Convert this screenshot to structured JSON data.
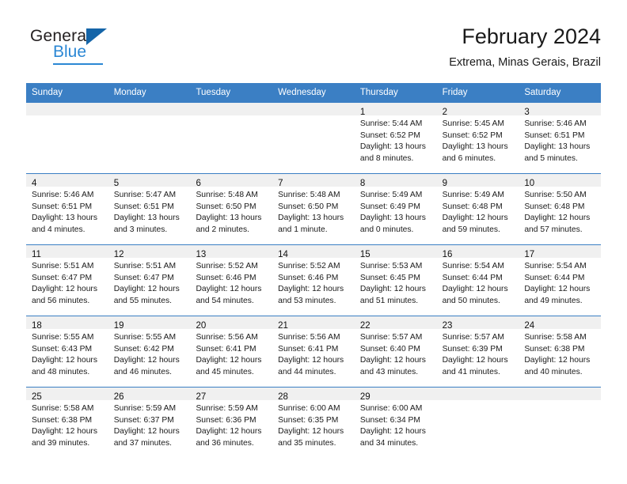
{
  "brand": {
    "name_top": "General",
    "name_bottom": "Blue",
    "accent_color": "#2b87d4",
    "triangle_color": "#1565a8"
  },
  "header": {
    "title": "February 2024",
    "subtitle": "Extrema, Minas Gerais, Brazil"
  },
  "calendar": {
    "header_bg": "#3b7fc4",
    "weekdays": [
      "Sunday",
      "Monday",
      "Tuesday",
      "Wednesday",
      "Thursday",
      "Friday",
      "Saturday"
    ],
    "weeks": [
      [
        {
          "day": "",
          "sunrise": "",
          "sunset": "",
          "daylight": "",
          "daylight2": ""
        },
        {
          "day": "",
          "sunrise": "",
          "sunset": "",
          "daylight": "",
          "daylight2": ""
        },
        {
          "day": "",
          "sunrise": "",
          "sunset": "",
          "daylight": "",
          "daylight2": ""
        },
        {
          "day": "",
          "sunrise": "",
          "sunset": "",
          "daylight": "",
          "daylight2": ""
        },
        {
          "day": "1",
          "sunrise": "Sunrise: 5:44 AM",
          "sunset": "Sunset: 6:52 PM",
          "daylight": "Daylight: 13 hours",
          "daylight2": "and 8 minutes."
        },
        {
          "day": "2",
          "sunrise": "Sunrise: 5:45 AM",
          "sunset": "Sunset: 6:52 PM",
          "daylight": "Daylight: 13 hours",
          "daylight2": "and 6 minutes."
        },
        {
          "day": "3",
          "sunrise": "Sunrise: 5:46 AM",
          "sunset": "Sunset: 6:51 PM",
          "daylight": "Daylight: 13 hours",
          "daylight2": "and 5 minutes."
        }
      ],
      [
        {
          "day": "4",
          "sunrise": "Sunrise: 5:46 AM",
          "sunset": "Sunset: 6:51 PM",
          "daylight": "Daylight: 13 hours",
          "daylight2": "and 4 minutes."
        },
        {
          "day": "5",
          "sunrise": "Sunrise: 5:47 AM",
          "sunset": "Sunset: 6:51 PM",
          "daylight": "Daylight: 13 hours",
          "daylight2": "and 3 minutes."
        },
        {
          "day": "6",
          "sunrise": "Sunrise: 5:48 AM",
          "sunset": "Sunset: 6:50 PM",
          "daylight": "Daylight: 13 hours",
          "daylight2": "and 2 minutes."
        },
        {
          "day": "7",
          "sunrise": "Sunrise: 5:48 AM",
          "sunset": "Sunset: 6:50 PM",
          "daylight": "Daylight: 13 hours",
          "daylight2": "and 1 minute."
        },
        {
          "day": "8",
          "sunrise": "Sunrise: 5:49 AM",
          "sunset": "Sunset: 6:49 PM",
          "daylight": "Daylight: 13 hours",
          "daylight2": "and 0 minutes."
        },
        {
          "day": "9",
          "sunrise": "Sunrise: 5:49 AM",
          "sunset": "Sunset: 6:48 PM",
          "daylight": "Daylight: 12 hours",
          "daylight2": "and 59 minutes."
        },
        {
          "day": "10",
          "sunrise": "Sunrise: 5:50 AM",
          "sunset": "Sunset: 6:48 PM",
          "daylight": "Daylight: 12 hours",
          "daylight2": "and 57 minutes."
        }
      ],
      [
        {
          "day": "11",
          "sunrise": "Sunrise: 5:51 AM",
          "sunset": "Sunset: 6:47 PM",
          "daylight": "Daylight: 12 hours",
          "daylight2": "and 56 minutes."
        },
        {
          "day": "12",
          "sunrise": "Sunrise: 5:51 AM",
          "sunset": "Sunset: 6:47 PM",
          "daylight": "Daylight: 12 hours",
          "daylight2": "and 55 minutes."
        },
        {
          "day": "13",
          "sunrise": "Sunrise: 5:52 AM",
          "sunset": "Sunset: 6:46 PM",
          "daylight": "Daylight: 12 hours",
          "daylight2": "and 54 minutes."
        },
        {
          "day": "14",
          "sunrise": "Sunrise: 5:52 AM",
          "sunset": "Sunset: 6:46 PM",
          "daylight": "Daylight: 12 hours",
          "daylight2": "and 53 minutes."
        },
        {
          "day": "15",
          "sunrise": "Sunrise: 5:53 AM",
          "sunset": "Sunset: 6:45 PM",
          "daylight": "Daylight: 12 hours",
          "daylight2": "and 51 minutes."
        },
        {
          "day": "16",
          "sunrise": "Sunrise: 5:54 AM",
          "sunset": "Sunset: 6:44 PM",
          "daylight": "Daylight: 12 hours",
          "daylight2": "and 50 minutes."
        },
        {
          "day": "17",
          "sunrise": "Sunrise: 5:54 AM",
          "sunset": "Sunset: 6:44 PM",
          "daylight": "Daylight: 12 hours",
          "daylight2": "and 49 minutes."
        }
      ],
      [
        {
          "day": "18",
          "sunrise": "Sunrise: 5:55 AM",
          "sunset": "Sunset: 6:43 PM",
          "daylight": "Daylight: 12 hours",
          "daylight2": "and 48 minutes."
        },
        {
          "day": "19",
          "sunrise": "Sunrise: 5:55 AM",
          "sunset": "Sunset: 6:42 PM",
          "daylight": "Daylight: 12 hours",
          "daylight2": "and 46 minutes."
        },
        {
          "day": "20",
          "sunrise": "Sunrise: 5:56 AM",
          "sunset": "Sunset: 6:41 PM",
          "daylight": "Daylight: 12 hours",
          "daylight2": "and 45 minutes."
        },
        {
          "day": "21",
          "sunrise": "Sunrise: 5:56 AM",
          "sunset": "Sunset: 6:41 PM",
          "daylight": "Daylight: 12 hours",
          "daylight2": "and 44 minutes."
        },
        {
          "day": "22",
          "sunrise": "Sunrise: 5:57 AM",
          "sunset": "Sunset: 6:40 PM",
          "daylight": "Daylight: 12 hours",
          "daylight2": "and 43 minutes."
        },
        {
          "day": "23",
          "sunrise": "Sunrise: 5:57 AM",
          "sunset": "Sunset: 6:39 PM",
          "daylight": "Daylight: 12 hours",
          "daylight2": "and 41 minutes."
        },
        {
          "day": "24",
          "sunrise": "Sunrise: 5:58 AM",
          "sunset": "Sunset: 6:38 PM",
          "daylight": "Daylight: 12 hours",
          "daylight2": "and 40 minutes."
        }
      ],
      [
        {
          "day": "25",
          "sunrise": "Sunrise: 5:58 AM",
          "sunset": "Sunset: 6:38 PM",
          "daylight": "Daylight: 12 hours",
          "daylight2": "and 39 minutes."
        },
        {
          "day": "26",
          "sunrise": "Sunrise: 5:59 AM",
          "sunset": "Sunset: 6:37 PM",
          "daylight": "Daylight: 12 hours",
          "daylight2": "and 37 minutes."
        },
        {
          "day": "27",
          "sunrise": "Sunrise: 5:59 AM",
          "sunset": "Sunset: 6:36 PM",
          "daylight": "Daylight: 12 hours",
          "daylight2": "and 36 minutes."
        },
        {
          "day": "28",
          "sunrise": "Sunrise: 6:00 AM",
          "sunset": "Sunset: 6:35 PM",
          "daylight": "Daylight: 12 hours",
          "daylight2": "and 35 minutes."
        },
        {
          "day": "29",
          "sunrise": "Sunrise: 6:00 AM",
          "sunset": "Sunset: 6:34 PM",
          "daylight": "Daylight: 12 hours",
          "daylight2": "and 34 minutes."
        },
        {
          "day": "",
          "sunrise": "",
          "sunset": "",
          "daylight": "",
          "daylight2": ""
        },
        {
          "day": "",
          "sunrise": "",
          "sunset": "",
          "daylight": "",
          "daylight2": ""
        }
      ]
    ]
  }
}
